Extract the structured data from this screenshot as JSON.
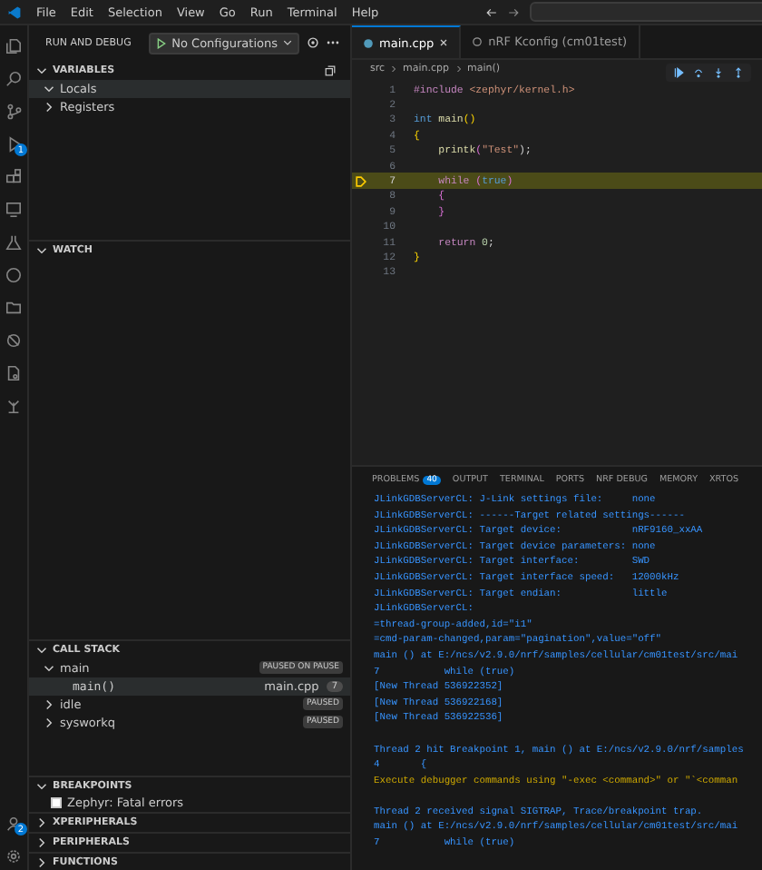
{
  "menu": [
    "File",
    "Edit",
    "Selection",
    "View",
    "Go",
    "Run",
    "Terminal",
    "Help"
  ],
  "activity_bar": {
    "debug_badge": "1",
    "accounts_badge": "2"
  },
  "sidebar": {
    "title": "RUN AND DEBUG",
    "configuration": "No Configurations",
    "variables": {
      "title": "VARIABLES",
      "expanded": true,
      "items": [
        {
          "label": "Locals",
          "expanded": true,
          "selected": true
        },
        {
          "label": "Registers",
          "expanded": false,
          "selected": false
        }
      ]
    },
    "watch": {
      "title": "WATCH",
      "expanded": true
    },
    "call_stack": {
      "title": "CALL STACK",
      "expanded": true,
      "threads": [
        {
          "name": "main",
          "expanded": true,
          "status": "PAUSED ON PAUSE",
          "frames": [
            {
              "name": "main()",
              "file": "main.cpp",
              "line": "7",
              "selected": true
            }
          ]
        },
        {
          "name": "idle",
          "expanded": false,
          "status": "PAUSED"
        },
        {
          "name": "sysworkq",
          "expanded": false,
          "status": "PAUSED"
        }
      ]
    },
    "breakpoints": {
      "title": "BREAKPOINTS",
      "expanded": true,
      "items": [
        {
          "label": "Zephyr: Fatal errors",
          "checked": false
        }
      ]
    },
    "collapsed_sections": [
      "XPERIPHERALS",
      "PERIPHERALS",
      "FUNCTIONS"
    ]
  },
  "editor": {
    "tabs": [
      {
        "label": "main.cpp",
        "selected": true
      },
      {
        "label": "nRF Kconfig (cm01test)",
        "selected": false
      }
    ],
    "breadcrumbs": [
      "src",
      "main.cpp",
      "main()"
    ],
    "lines": [
      {
        "number": "1",
        "current": false,
        "tokens": [
          {
            "text": "#include ",
            "kind": "preproc"
          },
          {
            "text": "<zephyr/kernel.h>",
            "kind": "string"
          }
        ]
      },
      {
        "number": "2",
        "current": false
      },
      {
        "number": "3",
        "current": false,
        "tokens": [
          {
            "text": "int ",
            "kind": "keyword"
          },
          {
            "text": "main",
            "kind": "function"
          },
          {
            "text": "()",
            "kind": "bracket"
          }
        ]
      },
      {
        "number": "4",
        "current": false,
        "tokens": [
          {
            "text": "{",
            "kind": "bracket"
          }
        ]
      },
      {
        "number": "5",
        "current": false,
        "tokens": [
          {
            "text": "    printk",
            "kind": "function"
          },
          {
            "text": "(",
            "kind": "bracket2"
          },
          {
            "text": "\"Test\"",
            "kind": "string"
          },
          {
            "text": ");",
            "kind": "plain"
          }
        ]
      },
      {
        "number": "6",
        "current": false
      },
      {
        "number": "7",
        "current": true,
        "tokens": [
          {
            "text": "    while ",
            "kind": "control"
          },
          {
            "text": "(",
            "kind": "bracket2"
          },
          {
            "text": "true",
            "kind": "keyword"
          },
          {
            "text": ")",
            "kind": "bracket2"
          }
        ]
      },
      {
        "number": "8",
        "current": false,
        "tokens": [
          {
            "text": "    {",
            "kind": "bracket2"
          }
        ]
      },
      {
        "number": "9",
        "current": false,
        "tokens": [
          {
            "text": "    }",
            "kind": "bracket2"
          }
        ]
      },
      {
        "number": "10",
        "current": false
      },
      {
        "number": "11",
        "current": false,
        "tokens": [
          {
            "text": "    return ",
            "kind": "control"
          },
          {
            "text": "0",
            "kind": "number"
          },
          {
            "text": ";",
            "kind": "plain"
          }
        ]
      },
      {
        "number": "12",
        "current": false,
        "tokens": [
          {
            "text": "}",
            "kind": "bracket"
          }
        ]
      },
      {
        "number": "13",
        "current": false
      }
    ]
  },
  "panel": {
    "tabs": [
      {
        "label": "PROBLEMS",
        "badge": "40"
      },
      {
        "label": "OUTPUT"
      },
      {
        "label": "TERMINAL"
      },
      {
        "label": "PORTS"
      },
      {
        "label": "NRF DEBUG"
      },
      {
        "label": "MEMORY"
      },
      {
        "label": "XRTOS"
      }
    ],
    "output": [
      {
        "kind": "info",
        "text": "JLinkGDBServerCL: J-Link settings file:     none"
      },
      {
        "kind": "info",
        "text": "JLinkGDBServerCL: ------Target related settings------"
      },
      {
        "kind": "info",
        "text": "JLinkGDBServerCL: Target device:            nRF9160_xxAA"
      },
      {
        "kind": "info",
        "text": "JLinkGDBServerCL: Target device parameters: none"
      },
      {
        "kind": "info",
        "text": "JLinkGDBServerCL: Target interface:         SWD"
      },
      {
        "kind": "info",
        "text": "JLinkGDBServerCL: Target interface speed:   12000kHz"
      },
      {
        "kind": "info",
        "text": "JLinkGDBServerCL: Target endian:            little"
      },
      {
        "kind": "info",
        "text": "JLinkGDBServerCL:"
      },
      {
        "kind": "info",
        "text": "=thread-group-added,id=\"i1\""
      },
      {
        "kind": "info",
        "text": "=cmd-param-changed,param=\"pagination\",value=\"off\""
      },
      {
        "kind": "info",
        "text": "main () at E:/ncs/v2.9.0/nrf/samples/cellular/cm01test/src/mai"
      },
      {
        "kind": "info",
        "text": "7           while (true)"
      },
      {
        "kind": "info",
        "text": "[New Thread 536922352]"
      },
      {
        "kind": "info",
        "text": "[New Thread 536922168]"
      },
      {
        "kind": "info",
        "text": "[New Thread 536922536]"
      },
      {
        "kind": "blank"
      },
      {
        "kind": "info",
        "text": "Thread 2 hit Breakpoint 1, main () at E:/ncs/v2.9.0/nrf/samples"
      },
      {
        "kind": "info",
        "text": "4       {"
      },
      {
        "kind": "warn",
        "text": "Execute debugger commands using \"-exec <command>\" or \"`<comman"
      },
      {
        "kind": "blank"
      },
      {
        "kind": "info",
        "text": "Thread 2 received signal SIGTRAP, Trace/breakpoint trap."
      },
      {
        "kind": "info",
        "text": "main () at E:/ncs/v2.9.0/nrf/samples/cellular/cm01test/src/mai"
      },
      {
        "kind": "info",
        "text": "7           while (true)"
      }
    ]
  }
}
